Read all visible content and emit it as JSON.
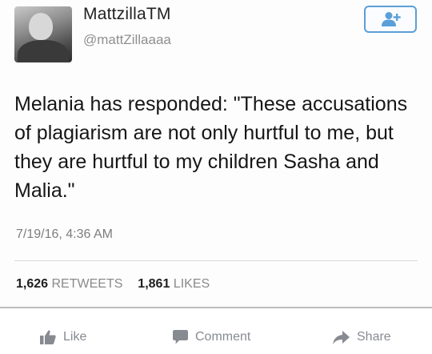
{
  "tweet": {
    "display_name": "MattzillaTM",
    "handle": "@mattZillaaaa",
    "text": "Melania has responded: \"These accusations of plagiarism are not only hurtful to me, but they are hurtful to my children Sasha and Malia.\"",
    "timestamp": "7/19/16, 4:36 AM",
    "retweets_count": "1,626",
    "retweets_label": "RETWEETS",
    "likes_count": "1,861",
    "likes_label": "LIKES",
    "follow_icon": "add-user-icon",
    "accent_color": "#5b9fd8"
  },
  "facebook_actions": {
    "like_label": "Like",
    "comment_label": "Comment",
    "share_label": "Share",
    "icons": [
      "thumbs-up-icon",
      "comment-icon",
      "share-arrow-icon"
    ],
    "icon_color": "#878b91"
  }
}
